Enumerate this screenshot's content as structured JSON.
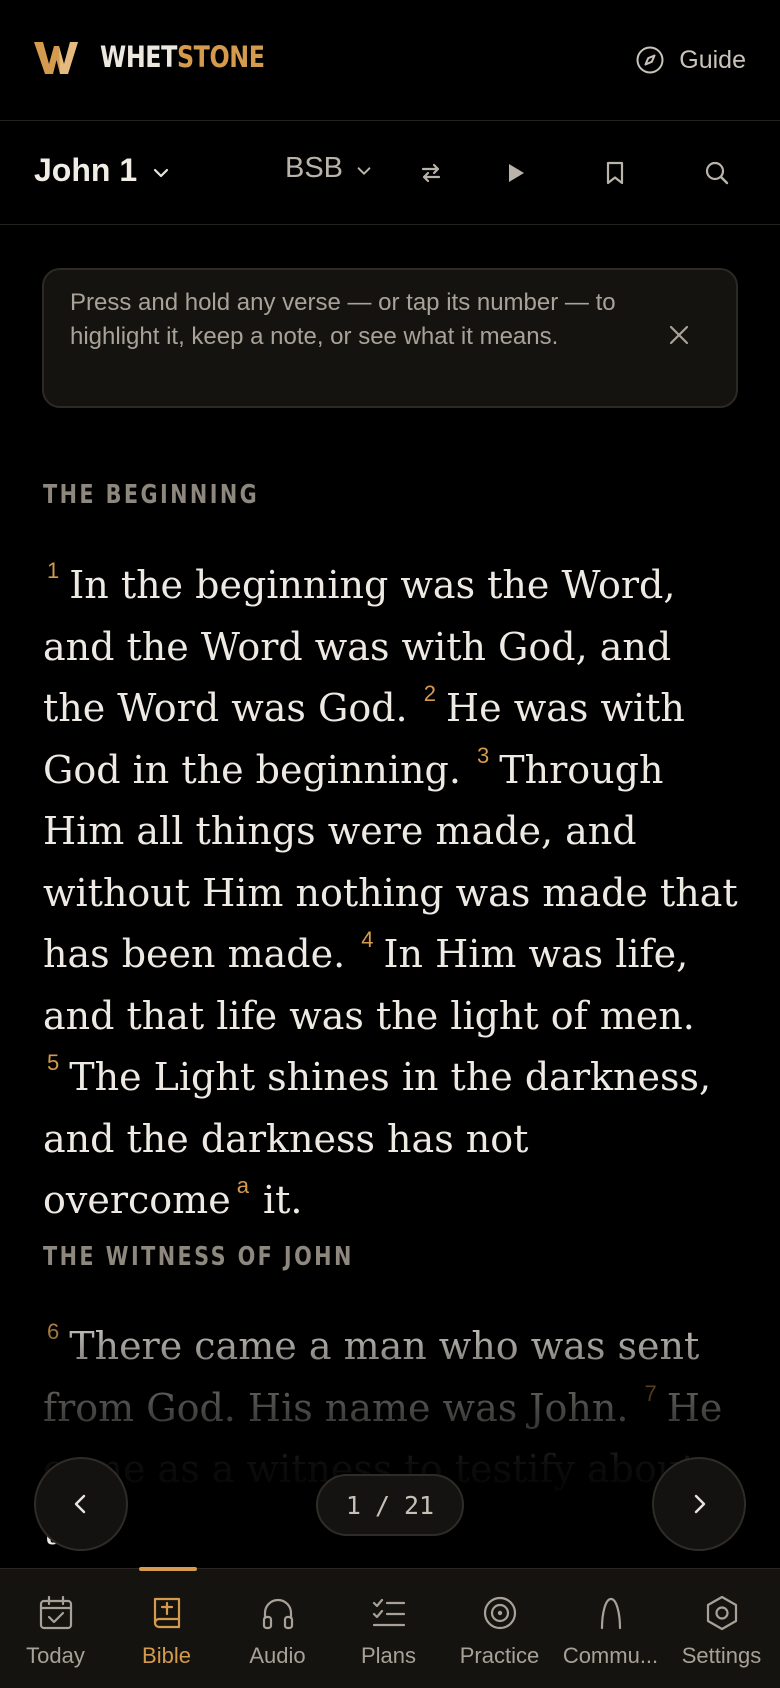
{
  "app": {
    "name_part1": "WHET",
    "name_part2": "STONE",
    "guide_label": "Guide",
    "accent_color": "#d49a4e"
  },
  "toolbar": {
    "chapter": "John 1",
    "version": "BSB",
    "icons": [
      "chevron-down-icon",
      "compare-icon",
      "play-icon",
      "bookmark-icon",
      "search-icon"
    ]
  },
  "tip": {
    "text": "Press and hold any verse — or tap its number — to highlight it, keep a note, or see what it means."
  },
  "reader": {
    "sections": [
      {
        "heading": "THE BEGINNING",
        "verses": [
          {
            "num": "1",
            "text": "In the beginning was the Word, and the Word was with God, and the Word was God."
          },
          {
            "num": "2",
            "text": "He was with God in the beginning."
          },
          {
            "num": "3",
            "text": "Through Him all things were made, and without Him nothing was made that has been made."
          },
          {
            "num": "4",
            "text": "In Him was life, and that life was the light of men."
          },
          {
            "num": "5",
            "text": "The Light shines in the darkness, and the darkness has not overcome",
            "footnote": "a",
            "after": "it."
          }
        ]
      },
      {
        "heading": "THE WITNESS OF JOHN",
        "verses": [
          {
            "num": "6",
            "text": "There came a man who was sent from God. His name was John."
          },
          {
            "num": "7",
            "text": "He came as a witness to testify about the"
          }
        ]
      }
    ]
  },
  "pager": {
    "current": "1",
    "separator": "/",
    "total": "21"
  },
  "nav": [
    {
      "label": "Today",
      "icon": "calendar-check-icon"
    },
    {
      "label": "Bible",
      "icon": "bible-icon",
      "active": true
    },
    {
      "label": "Audio",
      "icon": "headphones-icon"
    },
    {
      "label": "Plans",
      "icon": "checklist-icon"
    },
    {
      "label": "Practice",
      "icon": "target-icon"
    },
    {
      "label": "Commu...",
      "icon": "community-icon"
    },
    {
      "label": "Settings",
      "icon": "settings-icon"
    }
  ]
}
